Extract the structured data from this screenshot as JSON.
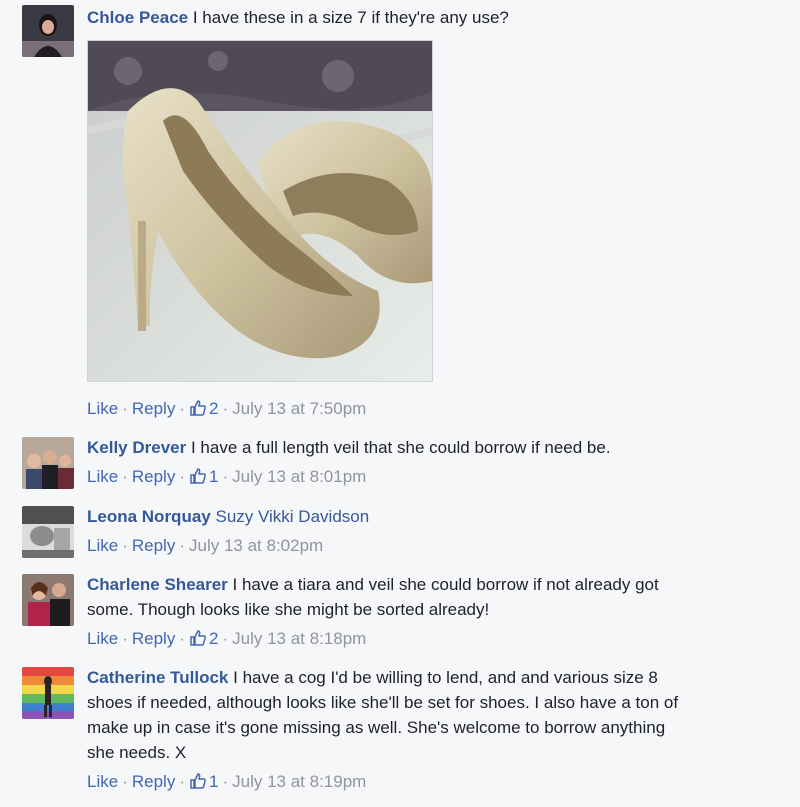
{
  "comments": [
    {
      "author": "Chloe Peace",
      "text": "I have these in a size 7 if they're any use?",
      "like_label": "Like",
      "reply_label": "Reply",
      "like_count": "2",
      "timestamp": "July 13 at 7:50pm",
      "attachment_icon": "photo-of-glitter-heels"
    },
    {
      "author": "Kelly Drever",
      "text": "I have a full length veil that she could borrow if need be.",
      "like_label": "Like",
      "reply_label": "Reply",
      "like_count": "1",
      "timestamp": "July 13 at 8:01pm"
    },
    {
      "author": "Leona Norquay",
      "mention": "Suzy Vikki Davidson",
      "like_label": "Like",
      "reply_label": "Reply",
      "timestamp": "July 13 at 8:02pm"
    },
    {
      "author": "Charlene Shearer",
      "text_line1": "I have a tiara and veil she could borrow if not already got",
      "text_line2": "some. Though looks like she might be sorted already!",
      "like_label": "Like",
      "reply_label": "Reply",
      "like_count": "2",
      "timestamp": "July 13 at 8:18pm"
    },
    {
      "author": "Catherine Tullock",
      "text_line1": "I have a cog I'd be willing to lend, and and various size 8",
      "text_line2": "shoes if needed, although looks like she'll be set for shoes. I also have a ton of",
      "text_line3": "make up in case it's gone missing as well. She's welcome to borrow anything",
      "text_line4": "she needs. X",
      "like_label": "Like",
      "reply_label": "Reply",
      "like_count": "1",
      "timestamp": "July 13 at 8:19pm"
    }
  ],
  "colors": {
    "background": "#f6f7f9",
    "author_link": "#365899",
    "action_link": "#4267b2",
    "meta_gray": "#90949c"
  }
}
